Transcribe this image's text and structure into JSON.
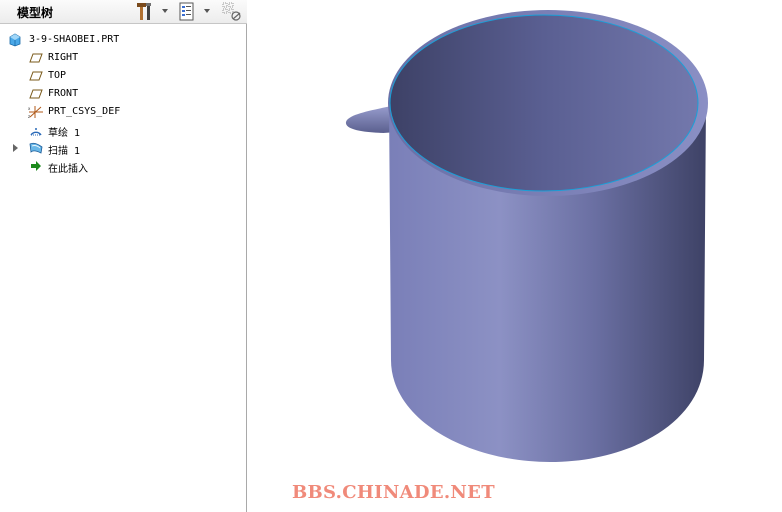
{
  "tree": {
    "title": "模型树",
    "root": "3-9-SHAOBEI.PRT",
    "items": [
      {
        "label": "RIGHT",
        "icon": "datum-plane-icon"
      },
      {
        "label": "TOP",
        "icon": "datum-plane-icon"
      },
      {
        "label": "FRONT",
        "icon": "datum-plane-icon"
      },
      {
        "label": "PRT_CSYS_DEF",
        "icon": "coordinate-system-icon"
      },
      {
        "label": "草绘 1",
        "icon": "sketch-icon"
      },
      {
        "label": "扫描 1",
        "icon": "sweep-icon",
        "expandable": true
      },
      {
        "label": "在此插入",
        "icon": "insert-here-arrow-icon"
      }
    ]
  },
  "header_icons": [
    "tools-icon",
    "tree-settings-icon",
    "filter-icon"
  ],
  "watermark": "BBS.CHINADE.NET",
  "colors": {
    "model_body": "#6e73a8",
    "model_edge": "#1aa0d8",
    "watermark": "#f08a7a",
    "insert_arrow": "#1c8a1c"
  }
}
